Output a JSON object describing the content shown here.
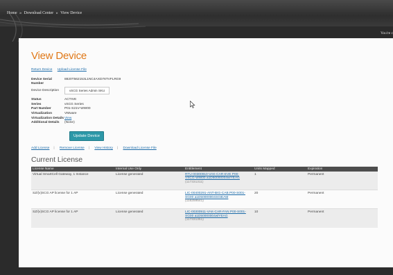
{
  "header": {
    "breadcrumb": [
      "Home",
      "»",
      "Download Center",
      "»",
      "View Device"
    ],
    "welcome": "You're c"
  },
  "page": {
    "title": "View Device",
    "links": [
      "Return Device",
      "Upload License File"
    ]
  },
  "device": {
    "serial_label": "Device Serial Number",
    "serial_value": "8820T562153L1NC4AXD76TVFLRG9",
    "desc_label": "Device Description",
    "desc_value": "vSCG Series Admin SKU",
    "status_label": "Status",
    "status_value": "ACTIVE",
    "series_label": "Series",
    "series_value": "vSCG Series",
    "part_label": "Part Number",
    "part_value": "P01-S21V-WW00",
    "virt_label": "Virtualization",
    "virt_value": "VMware",
    "virt_details_label": "Virtualization Details",
    "virt_details_value": "View",
    "additional_label": "Additional Details",
    "additional_value": "(None)"
  },
  "buttons": {
    "update": "Update Device"
  },
  "actions": [
    "Add License",
    "Remove License",
    "View History",
    "Download License File"
  ],
  "licenses": {
    "title": "Current License",
    "columns": [
      "License Name",
      "Internal Use Only",
      "Entitlement",
      "Units Mapped",
      "Expiration"
    ],
    "rows": [
      {
        "name": "Virtual SmartCell Gateway, 1 Instance",
        "internal": "License generated",
        "entitlement_l1": "RTU-00300910-VAK-CAR-EVE P00-",
        "entitlement_l2": "VSCG-WW00 a1D50000004wlYEAG",
        "entitlement_id": "(117331311)",
        "units": "1",
        "expiration": "Permanent"
      },
      {
        "name": "SZ/(v)SCG AP license for 1 AP",
        "internal": "License generated",
        "entitlement_l1": "LIC-00400291-ANT-BIG-CAB P00-S001-",
        "entitlement_l2": "SG00 a1D50000004SGIEAM",
        "entitlement_id": "(116259541)",
        "units": "20",
        "expiration": "Permanent"
      },
      {
        "name": "SZ/(v)SCG AP license for 1 AP",
        "internal": "License generated",
        "entitlement_l1": "LIC-00300911-VAK-CAR-FAN P00-S001-",
        "entitlement_l2": "SG00 a1D50000004wlYEAG",
        "entitlement_id": "(117331351)",
        "units": "10",
        "expiration": "Permanent"
      }
    ]
  },
  "colors": {
    "title": "#e07817",
    "link": "#1a6aa8",
    "button": "#2d98a8",
    "table_header": "#4d4d4d"
  },
  "icons": {
    "cursor": "mouse-pointer-icon"
  }
}
